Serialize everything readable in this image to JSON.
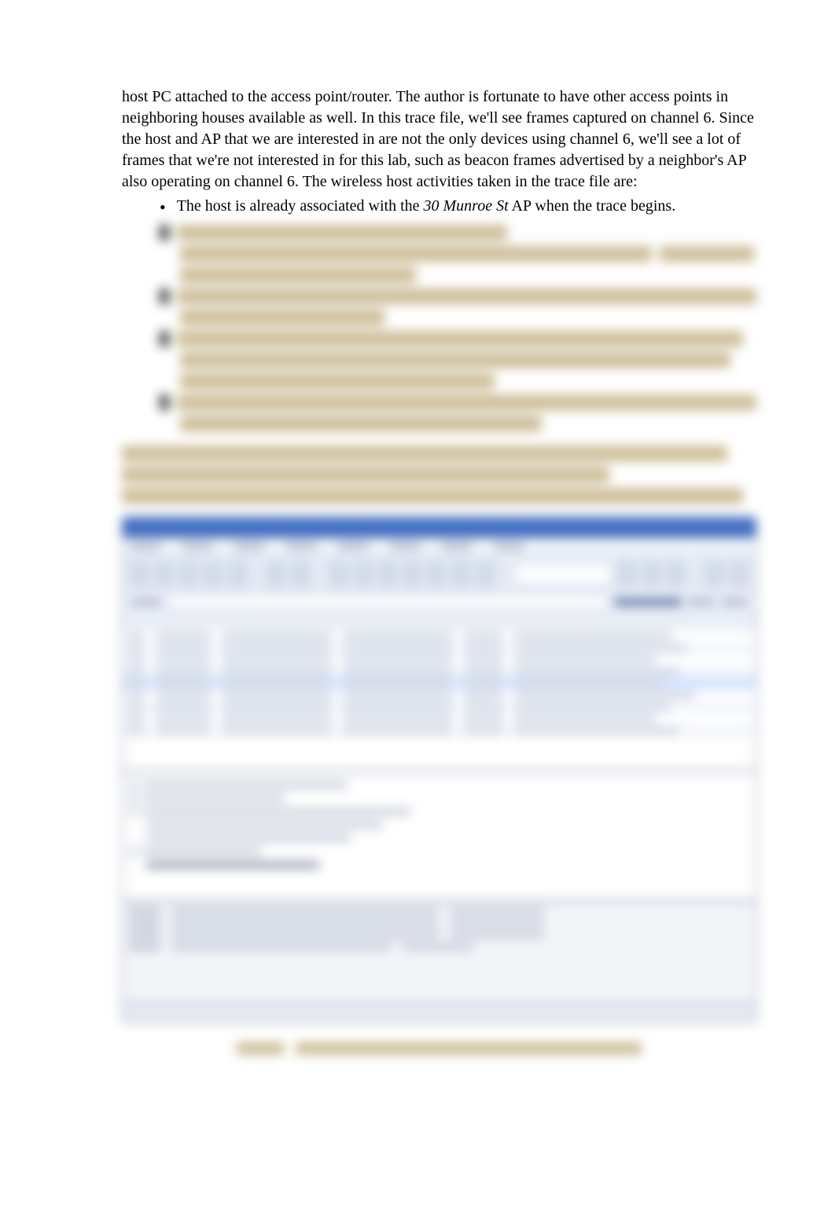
{
  "paragraph_lead": "host PC attached to the access point/router. The author is fortunate to have other access points in neighboring houses available as well.  In this trace file, we'll see frames captured on channel 6.  Since the host and AP that we are interested in are not the only devices using channel 6, we'll see a lot of frames that we're not interested in for this lab, such as beacon frames advertised by a neighbor's AP also operating on channel 6.  The wireless host activities taken in the trace file are:",
  "bullets": {
    "b1_pre": "The host is already associated with the ",
    "b1_em": "30 Munroe St",
    "b1_post": " AP when the trace begins."
  }
}
